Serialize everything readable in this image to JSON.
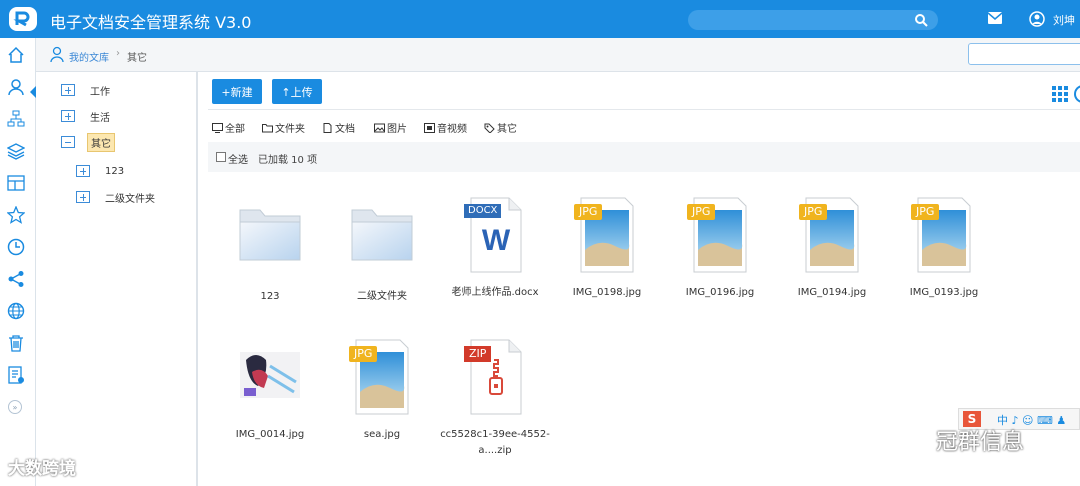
{
  "app": {
    "title": "电子文档安全管理系统 V3.0",
    "user_name": "刘坤"
  },
  "breadcrumb": {
    "home": "我的文库",
    "separator": "›",
    "current": "其它"
  },
  "tree": [
    {
      "label": "工作",
      "expand": "plus",
      "level": 0,
      "selected": false
    },
    {
      "label": "生活",
      "expand": "plus",
      "level": 0,
      "selected": false
    },
    {
      "label": "其它",
      "expand": "minus",
      "level": 0,
      "selected": true
    },
    {
      "label": "123",
      "expand": "plus",
      "level": 1,
      "selected": false
    },
    {
      "label": "二级文件夹",
      "expand": "plus",
      "level": 1,
      "selected": false
    }
  ],
  "toolbar": {
    "new_label": "+新建",
    "upload_label": "↑上传"
  },
  "filters": [
    "全部",
    "文件夹",
    "文档",
    "图片",
    "音视频",
    "其它"
  ],
  "selection": {
    "select_all": "全选",
    "loaded": "已加载 10 项"
  },
  "files": [
    {
      "name": "123",
      "type": "folder"
    },
    {
      "name": "二级文件夹",
      "type": "folder"
    },
    {
      "name": "老师上线作品.docx",
      "type": "docx",
      "badge": "DOCX"
    },
    {
      "name": "IMG_0198.jpg",
      "type": "jpg",
      "badge": "JPG"
    },
    {
      "name": "IMG_0196.jpg",
      "type": "jpg",
      "badge": "JPG"
    },
    {
      "name": "IMG_0194.jpg",
      "type": "jpg",
      "badge": "JPG"
    },
    {
      "name": "IMG_0193.jpg",
      "type": "jpg",
      "badge": "JPG"
    },
    {
      "name": "IMG_0014.jpg",
      "type": "photo"
    },
    {
      "name": "sea.jpg",
      "type": "jpg",
      "badge": "JPG"
    },
    {
      "name": "cc5528c1-39ee-4552-a....zip",
      "type": "zip",
      "badge": "ZIP"
    }
  ],
  "watermarks": {
    "left": "大数跨境",
    "right": "冠群信息"
  },
  "ime": {
    "logo": "S",
    "text": "中 ♪ ☺ ⌨ ♟"
  },
  "colors": {
    "primary": "#1a8be0",
    "selected_bg": "#fce7b0"
  }
}
